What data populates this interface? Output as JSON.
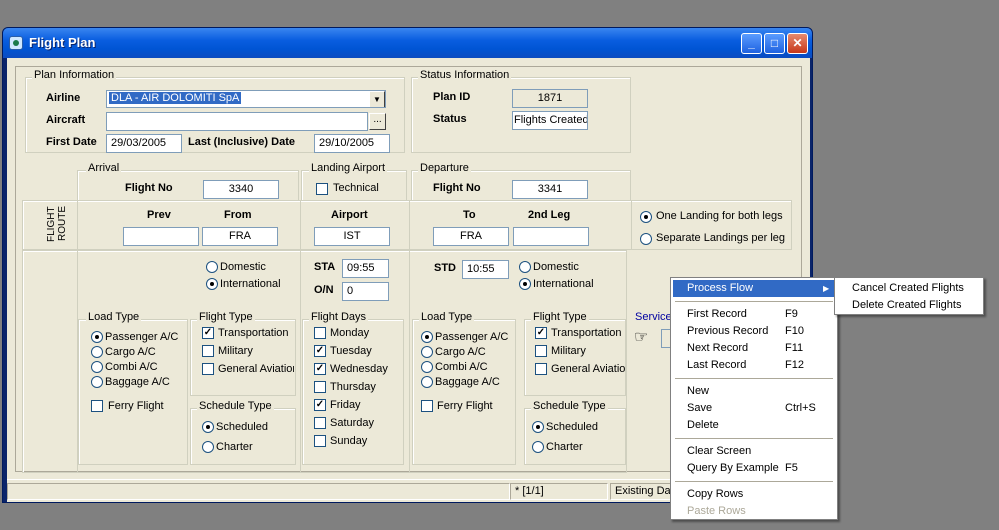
{
  "window": {
    "title": "Flight Plan",
    "min_label": "_",
    "max_label": "□",
    "close_label": "✕"
  },
  "plan_info": {
    "legend": "Plan Information",
    "airline_label": "Airline",
    "airline_value": "DLA - AIR DOLOMITI SpA",
    "aircraft_label": "Aircraft",
    "aircraft_value": "",
    "lookup_label": "...",
    "first_date_label": "First Date",
    "first_date_value": "29/03/2005",
    "last_date_label": "Last (Inclusive) Date",
    "last_date_value": "29/10/2005"
  },
  "status_info": {
    "legend": "Status Information",
    "plan_id_label": "Plan ID",
    "plan_id_value": "1871",
    "status_label": "Status",
    "status_value": "Flights Created"
  },
  "arrival": {
    "legend": "Arrival",
    "flight_no_label": "Flight No",
    "flight_no_value": "3340",
    "prev_label": "Prev",
    "prev_value": "",
    "from_label": "From",
    "from_value": "FRA",
    "domestic_label": "Domestic",
    "international_label": "International",
    "load_type": {
      "legend": "Load Type",
      "options": [
        "Passenger A/C",
        "Cargo A/C",
        "Combi A/C",
        "Baggage A/C"
      ],
      "selected": "Passenger A/C"
    },
    "ferry_label": "Ferry Flight",
    "flight_type": {
      "legend": "Flight Type",
      "options": [
        "Transportation",
        "Military",
        "General Aviation"
      ],
      "checked": [
        "Transportation"
      ]
    },
    "schedule_type": {
      "legend": "Schedule Type",
      "options": [
        "Scheduled",
        "Charter"
      ],
      "selected": "Scheduled"
    }
  },
  "landing_airport": {
    "legend": "Landing Airport",
    "technical_label": "Technical",
    "airport_label": "Airport",
    "airport_value": "IST",
    "sta_label": "STA",
    "sta_value": "09:55",
    "on_label": "O/N",
    "on_value": "0",
    "flight_days": {
      "legend": "Flight Days",
      "days": [
        "Monday",
        "Tuesday",
        "Wednesday",
        "Thursday",
        "Friday",
        "Saturday",
        "Sunday"
      ],
      "checked": [
        "Tuesday",
        "Wednesday",
        "Friday"
      ]
    }
  },
  "flight_route_label": "FLIGHT ROUTE",
  "departure": {
    "legend": "Departure",
    "flight_no_label": "Flight No",
    "flight_no_value": "3341",
    "to_label": "To",
    "to_value": "FRA",
    "second_leg_label": "2nd Leg",
    "second_leg_value": "",
    "std_label": "STD",
    "std_value": "10:55",
    "domestic_label": "Domestic",
    "international_label": "International",
    "load_type": {
      "legend": "Load Type",
      "options": [
        "Passenger A/C",
        "Cargo A/C",
        "Combi A/C",
        "Baggage A/C"
      ],
      "selected": "Passenger A/C"
    },
    "ferry_label": "Ferry Flight",
    "flight_type": {
      "legend": "Flight Type",
      "options": [
        "Transportation",
        "Military",
        "General Aviation"
      ],
      "checked": [
        "Transportation"
      ]
    },
    "schedule_type": {
      "legend": "Schedule Type",
      "options": [
        "Scheduled",
        "Charter"
      ],
      "selected": "Scheduled"
    }
  },
  "landing_option": {
    "one_landing": "One Landing for both legs",
    "separate_landings": "Separate Landings per leg",
    "selected": "One Landing for both legs"
  },
  "services_label": "Service",
  "statusbar": {
    "record": "* [1/1]",
    "mode": "Existing Dat"
  },
  "context_menu": {
    "items": [
      {
        "label": "Process Flow",
        "shortcut": "",
        "submenu": true,
        "highlighted": true
      },
      {
        "sep": true
      },
      {
        "label": "First Record",
        "shortcut": "F9"
      },
      {
        "label": "Previous Record",
        "shortcut": "F10"
      },
      {
        "label": "Next Record",
        "shortcut": "F11"
      },
      {
        "label": "Last Record",
        "shortcut": "F12"
      },
      {
        "sep": true
      },
      {
        "label": "New",
        "shortcut": ""
      },
      {
        "label": "Save",
        "shortcut": "Ctrl+S"
      },
      {
        "label": "Delete",
        "shortcut": ""
      },
      {
        "sep": true
      },
      {
        "label": "Clear Screen",
        "shortcut": ""
      },
      {
        "label": "Query By Example",
        "shortcut": "F5"
      },
      {
        "sep": true
      },
      {
        "label": "Copy Rows",
        "shortcut": ""
      },
      {
        "label": "Paste Rows",
        "shortcut": "",
        "disabled": true
      }
    ],
    "submenu": [
      "Cancel Created Flights",
      "Delete Created Flights"
    ],
    "submenu_arrow": "▶"
  },
  "colors": {
    "titlebar": "#0055d4",
    "menu_highlight": "#316ac5",
    "face": "#ece9d8"
  }
}
